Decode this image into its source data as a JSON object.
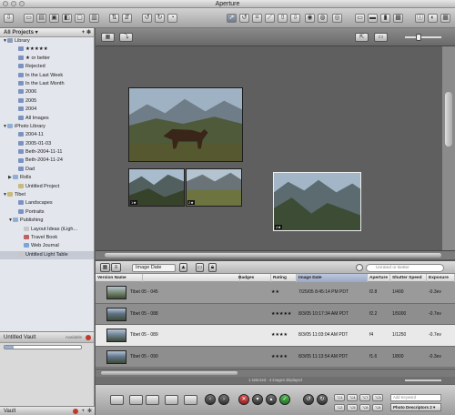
{
  "window": {
    "title": "Aperture"
  },
  "projects_panel": {
    "header": "All Projects",
    "tree": [
      {
        "label": "Library",
        "indent": 0,
        "tri": "▼",
        "icon": "library"
      },
      {
        "label": "★★★★★",
        "indent": 2,
        "icon": "album"
      },
      {
        "label": "★ or better",
        "indent": 2,
        "icon": "album"
      },
      {
        "label": "Rejected",
        "indent": 2,
        "icon": "album"
      },
      {
        "label": "In the Last Week",
        "indent": 2,
        "icon": "album"
      },
      {
        "label": "In the Last Month",
        "indent": 2,
        "icon": "album"
      },
      {
        "label": "2006",
        "indent": 2,
        "icon": "album"
      },
      {
        "label": "2005",
        "indent": 2,
        "icon": "album"
      },
      {
        "label": "2004",
        "indent": 2,
        "icon": "album"
      },
      {
        "label": "All Images",
        "indent": 2,
        "icon": "album"
      },
      {
        "label": "iPhoto Library",
        "indent": 0,
        "tri": "▼",
        "icon": "folder"
      },
      {
        "label": "2004-11",
        "indent": 2,
        "icon": "album"
      },
      {
        "label": "2005-01-03",
        "indent": 2,
        "icon": "album"
      },
      {
        "label": "Beth-2004-11-11",
        "indent": 2,
        "icon": "album"
      },
      {
        "label": "Beth-2004-11-24",
        "indent": 2,
        "icon": "album"
      },
      {
        "label": "Dad",
        "indent": 2,
        "icon": "album"
      },
      {
        "label": "Rolls",
        "indent": 1,
        "tri": "▶",
        "icon": "folder"
      },
      {
        "label": "Untitled Project",
        "indent": 2,
        "icon": "project"
      },
      {
        "label": "Tibet",
        "indent": 0,
        "tri": "▼",
        "icon": "project"
      },
      {
        "label": "Landscapes",
        "indent": 2,
        "icon": "album"
      },
      {
        "label": "Portraits",
        "indent": 2,
        "icon": "album"
      },
      {
        "label": "Publishing",
        "indent": 1,
        "tri": "▼",
        "icon": "folder"
      },
      {
        "label": "Layout Ideas (iLigh...",
        "indent": 3,
        "icon": "lighttable"
      },
      {
        "label": "Travel Book",
        "indent": 3,
        "icon": "book"
      },
      {
        "label": "Web Journal",
        "indent": 3,
        "icon": "web"
      },
      {
        "label": "Untitled Light Table",
        "indent": 2,
        "icon": "lighttable",
        "selected": true
      }
    ]
  },
  "vault_panel": {
    "name": "Untitled Vault",
    "status": "Available",
    "progress": 0.12,
    "footer_label": "Vault"
  },
  "browser": {
    "sort_value": "Image Date",
    "search_placeholder": "Unrated or Better",
    "columns": [
      "Version Name",
      "Badges",
      "Rating",
      "Image Date",
      "Aperture",
      "Shutter Speed",
      "Exposure"
    ],
    "rows": [
      {
        "name": "Tibet 05 -  045",
        "rating": "★★",
        "date": "7/25/05 8:45:14 PM PDT",
        "aperture": "f2.8",
        "shutter": "1/400",
        "exposure": "-0.3ev"
      },
      {
        "name": "Tibet 05 -  088",
        "rating": "★★★★★",
        "date": "8/3/05 10:17:34 AM PDT",
        "aperture": "f2.2",
        "shutter": "1/5000",
        "exposure": "-0.7ev"
      },
      {
        "name": "Tibet 05 -  089",
        "rating": "★★★★",
        "date": "8/3/05 11:03:04 AM PDT",
        "aperture": "f4",
        "shutter": "1/1250",
        "exposure": "-0.7ev",
        "selected": true
      },
      {
        "name": "Tibet 05 -  090",
        "rating": "★★★★",
        "date": "8/3/05 11:13:54 AM PDT",
        "aperture": "f1.6",
        "shutter": "1/800",
        "exposure": "-0.3ev"
      }
    ],
    "status_text": "1 selected - 4 images displayed"
  },
  "lighttable_tags": [
    "1★",
    "2★",
    "4★",
    "5★"
  ],
  "bottom_bar": {
    "keyword_placeholder": "Add Keyword",
    "keyword_set": "Photo Descriptors 2"
  },
  "colors": {
    "selection": "#c4c9d4",
    "lighttable_bg": "#5f5f5f",
    "reject": "#c0392b"
  }
}
